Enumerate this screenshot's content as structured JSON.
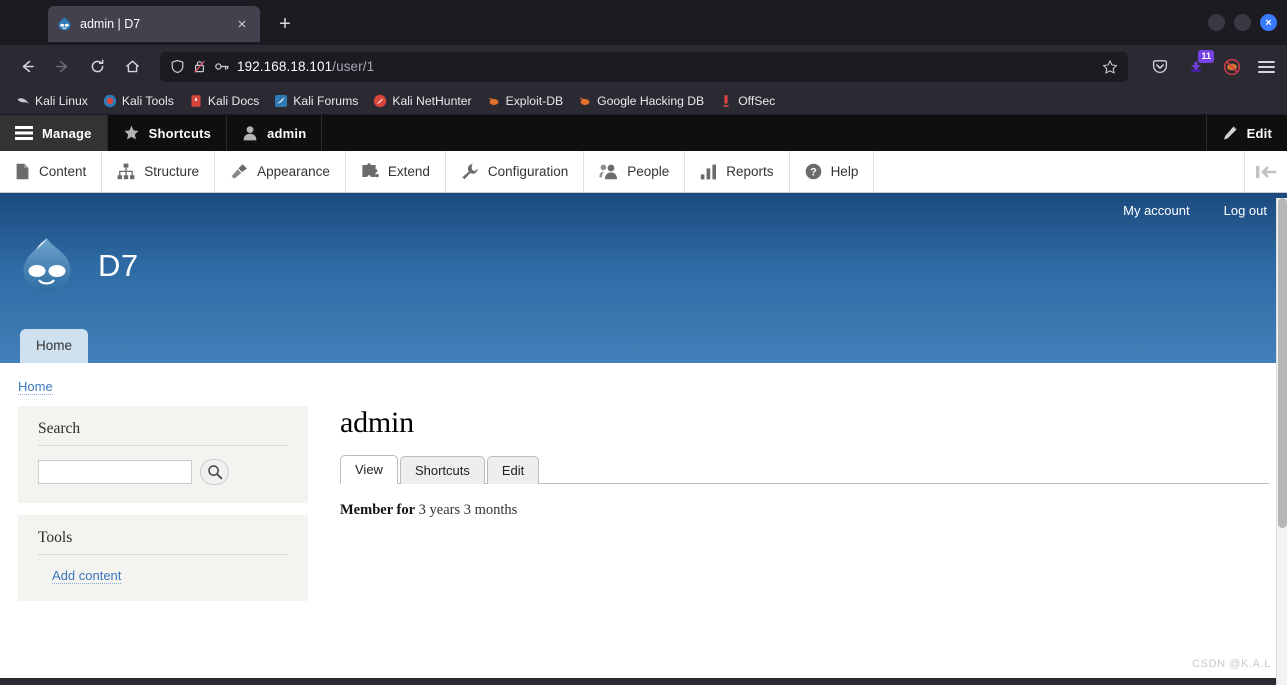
{
  "browser": {
    "tab": {
      "title": "admin | D7",
      "favicon": "drupal-drop-icon",
      "close": "×"
    },
    "newtab_label": "+",
    "window_controls": {
      "minimize": "",
      "maximize": "",
      "close": "×"
    },
    "nav": {
      "back": "←",
      "forward": "→",
      "reload": "↻",
      "home": "home-icon"
    },
    "url": {
      "host": "192.168.18.101",
      "path": "/user/1",
      "shield": "shield-icon",
      "lock": "lock-crossed-icon",
      "key": "key-icon",
      "bookmark": "star-icon"
    },
    "toolbar_right": {
      "pocket": "pocket-icon",
      "downloads_badge": "11",
      "extension": "blocked-icon",
      "menu": "hamburger-icon"
    },
    "bookmarks": [
      {
        "label": "Kali Linux",
        "icon": "kali-dragon-icon"
      },
      {
        "label": "Kali Tools",
        "icon": "kali-tools-icon"
      },
      {
        "label": "Kali Docs",
        "icon": "kali-docs-icon"
      },
      {
        "label": "Kali Forums",
        "icon": "kali-forums-icon"
      },
      {
        "label": "Kali NetHunter",
        "icon": "kali-nethunter-icon"
      },
      {
        "label": "Exploit-DB",
        "icon": "exploitdb-icon"
      },
      {
        "label": "Google Hacking DB",
        "icon": "ghdb-icon"
      },
      {
        "label": "OffSec",
        "icon": "offsec-icon"
      }
    ]
  },
  "admin_toolbar": {
    "manage": "Manage",
    "shortcuts": "Shortcuts",
    "user": "admin",
    "edit": "Edit"
  },
  "admin_menu": {
    "items": [
      {
        "label": "Content",
        "icon": "document-icon"
      },
      {
        "label": "Structure",
        "icon": "sitemap-icon"
      },
      {
        "label": "Appearance",
        "icon": "paintbrush-icon"
      },
      {
        "label": "Extend",
        "icon": "puzzle-icon"
      },
      {
        "label": "Configuration",
        "icon": "wrench-icon"
      },
      {
        "label": "People",
        "icon": "people-icon"
      },
      {
        "label": "Reports",
        "icon": "barchart-icon"
      },
      {
        "label": "Help",
        "icon": "question-icon"
      }
    ],
    "orientation_toggle": "orientation-toggle-icon"
  },
  "site_header": {
    "name": "D7",
    "logo": "drupal-drop-logo",
    "user_links": [
      {
        "label": "My account"
      },
      {
        "label": "Log out"
      }
    ],
    "primary_tabs": [
      {
        "label": "Home",
        "active": true
      }
    ]
  },
  "breadcrumb": [
    {
      "label": "Home"
    }
  ],
  "sidebar": {
    "blocks": [
      {
        "title": "Search",
        "type": "search",
        "input_value": "",
        "input_placeholder": "",
        "button_icon": "magnifier-icon"
      },
      {
        "title": "Tools",
        "type": "links",
        "links": [
          {
            "label": "Add content"
          }
        ]
      }
    ]
  },
  "main": {
    "title": "admin",
    "tabs": [
      {
        "label": "View",
        "active": true
      },
      {
        "label": "Shortcuts",
        "active": false
      },
      {
        "label": "Edit",
        "active": false
      }
    ],
    "member_label": "Member for",
    "member_value": "3 years 3 months"
  },
  "watermark": "CSDN @K.A.L",
  "colors": {
    "header_top": "#1b4a7f",
    "header_bottom": "#4180b8",
    "link": "#3a77bd",
    "toolbar_bg": "#0f0f0f",
    "block_bg": "#f3f3ef",
    "badge": "#7542e4",
    "close_button": "#3a7afe"
  }
}
